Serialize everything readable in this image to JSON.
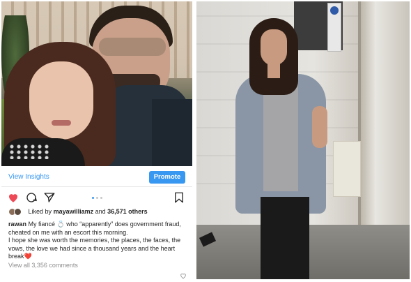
{
  "post": {
    "insights_label": "View Insights",
    "promote_label": "Promote",
    "likes": {
      "prefix": "Liked by",
      "user": "mayawilliamz",
      "connector": "and",
      "count": "36,571 others"
    },
    "caption": {
      "username": "rawan",
      "line1": " My fiancé 💍 who “apparently” does government fraud, cheated on me with an escort this morning.",
      "line2": "I hope she was worth the memories, the places, the faces, the vows, the love we had since a thousand years and the heart break❤️"
    },
    "view_comments": "View all 3,356 comments"
  },
  "colors": {
    "accent_blue": "#3897f0",
    "like_red": "#ed4956"
  }
}
